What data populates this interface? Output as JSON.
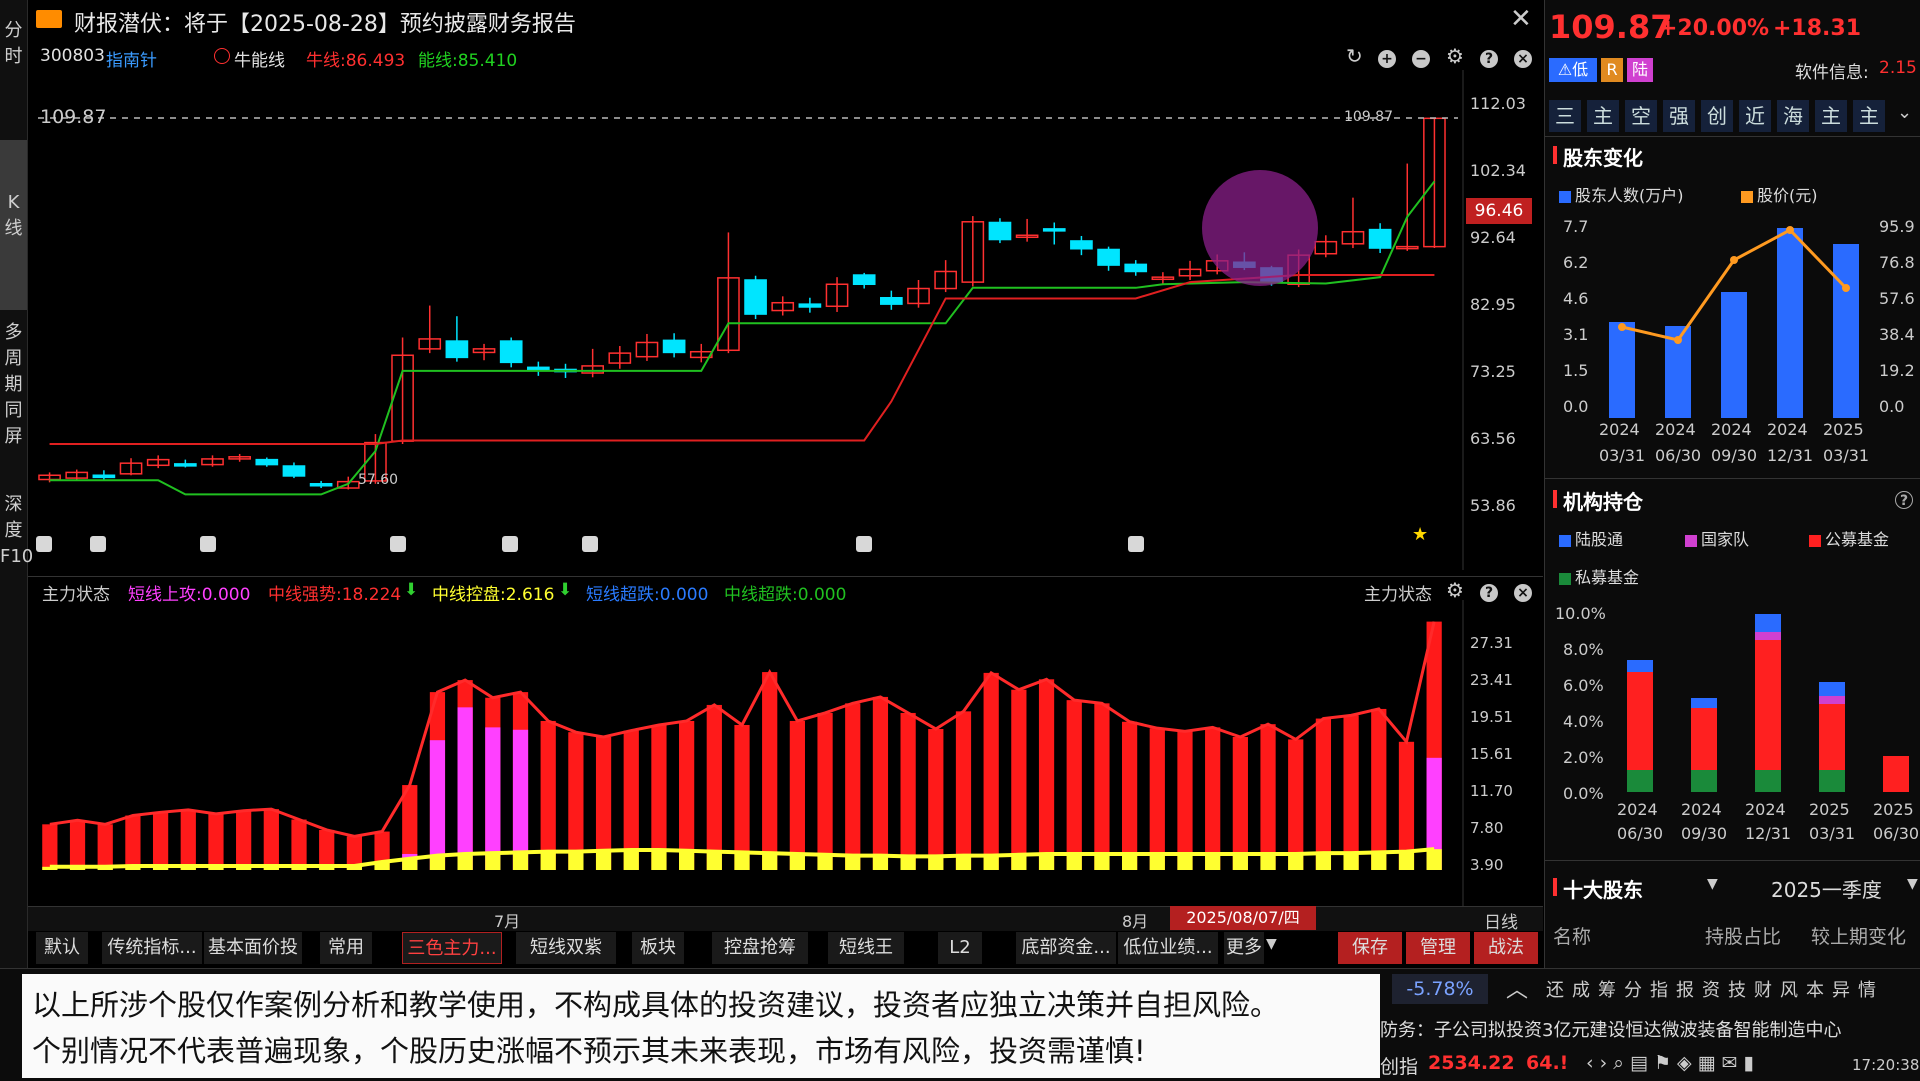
{
  "leftbar": {
    "tabs": [
      "分时",
      "K线",
      "多周期同屏",
      "深度F10"
    ]
  },
  "header": {
    "title": "财报潜伏：将于【2025-08-28】预约披露财务报告",
    "stock_code": "300803",
    "stock_name": "指南针",
    "indicator_name": "牛能线",
    "niu_label": "牛线:86.493",
    "neng_label": "能线:85.410"
  },
  "kchart": {
    "price_ticks": [
      "112.03",
      "102.34",
      "92.64",
      "82.95",
      "73.25",
      "63.56",
      "53.86"
    ],
    "current_price_tag": "96.46",
    "dashed_level_left": "109.87",
    "dashed_level_right": "109.87",
    "low_label": "57.60",
    "colors": {
      "up": "#ff3030",
      "down": "#00e5ff",
      "green_line": "#20c020",
      "red_line": "#e02020"
    }
  },
  "subchart": {
    "title": "主力状态",
    "title_right": "主力状态",
    "labels": [
      {
        "text": "短线上攻:0.000",
        "color": "#ff40ff"
      },
      {
        "text": "中线强势:18.224",
        "color": "#ff3030",
        "arrow": "⬇"
      },
      {
        "text": "中线控盘:2.616",
        "color": "#ffff30",
        "arrow": "⬇"
      },
      {
        "text": "短线超跌:0.000",
        "color": "#2a7bff"
      },
      {
        "text": "中线超跌:0.000",
        "color": "#20c020"
      }
    ],
    "ticks": [
      "27.31",
      "23.41",
      "19.51",
      "15.61",
      "11.70",
      "7.80",
      "3.90"
    ]
  },
  "timeaxis": {
    "month1": "7月",
    "month2": "8月",
    "cursor_date": "2025/08/07/四",
    "period": "日线"
  },
  "toolbar": {
    "tabs": [
      "默认",
      "传统指标...",
      "基本面价投",
      "常用",
      "三色主力...",
      "短线双紫",
      "板块",
      "控盘抢筹",
      "短线王",
      "L2",
      "底部资金...",
      "低位业绩..."
    ],
    "more": "更多",
    "save": "保存",
    "manage": "管理",
    "strategy": "战法"
  },
  "disclaimer": {
    "line1": "以上所涉个股仅作案例分析和教学使用，不构成具体的投资建议，投资者应独立决策并自担风险。",
    "line2": "个别情况不代表普遍现象，个股历史涨幅不预示其未来表现，市场有风险，投资需谨慎!"
  },
  "quote": {
    "price": "109.87",
    "change_pct": "+20.00%",
    "change_abs": "+18.31",
    "tag_low": "低",
    "tag_r": "R",
    "tag_lu": "陆",
    "software_info_label": "软件信息:",
    "software_info_value": "2.15",
    "toolbar": [
      "三",
      "主",
      "空",
      "强",
      "创",
      "近",
      "海",
      "主",
      "主"
    ]
  },
  "shareholders": {
    "title": "股东变化",
    "legend": [
      "股东人数(万户)",
      "股价(元)"
    ],
    "left_ticks": [
      "7.7",
      "6.2",
      "4.6",
      "3.1",
      "1.5",
      "0.0"
    ],
    "right_ticks": [
      "95.9",
      "76.8",
      "57.6",
      "38.4",
      "19.2",
      "0.0"
    ],
    "x_years": [
      "2024",
      "2024",
      "2024",
      "2024",
      "2025"
    ],
    "x_dates": [
      "03/31",
      "06/30",
      "09/30",
      "12/31",
      "03/31"
    ]
  },
  "institutions": {
    "title": "机构持仓",
    "help": "?",
    "legend": [
      "陆股通",
      "国家队",
      "公募基金",
      "私募基金"
    ],
    "ticks": [
      "10.0%",
      "8.0%",
      "6.0%",
      "4.0%",
      "2.0%",
      "0.0%"
    ],
    "x_years": [
      "2024",
      "2024",
      "2024",
      "2025",
      "2025"
    ],
    "x_dates": [
      "06/30",
      "09/30",
      "12/31",
      "03/31",
      "06/30"
    ]
  },
  "top_holders": {
    "title": "十大股东",
    "period": "2025一季度",
    "col_name": "名称",
    "col_pct": "持股占比",
    "col_change": "较上期变化"
  },
  "statusbar": {
    "change": "-5.78%",
    "news": "防务：子公司拟投资3亿元建设恒达微波装备智能制造中心",
    "index_name": "创指",
    "index_value": "2534.22",
    "index_change": "64.!",
    "time": "17:20:38"
  }
}
